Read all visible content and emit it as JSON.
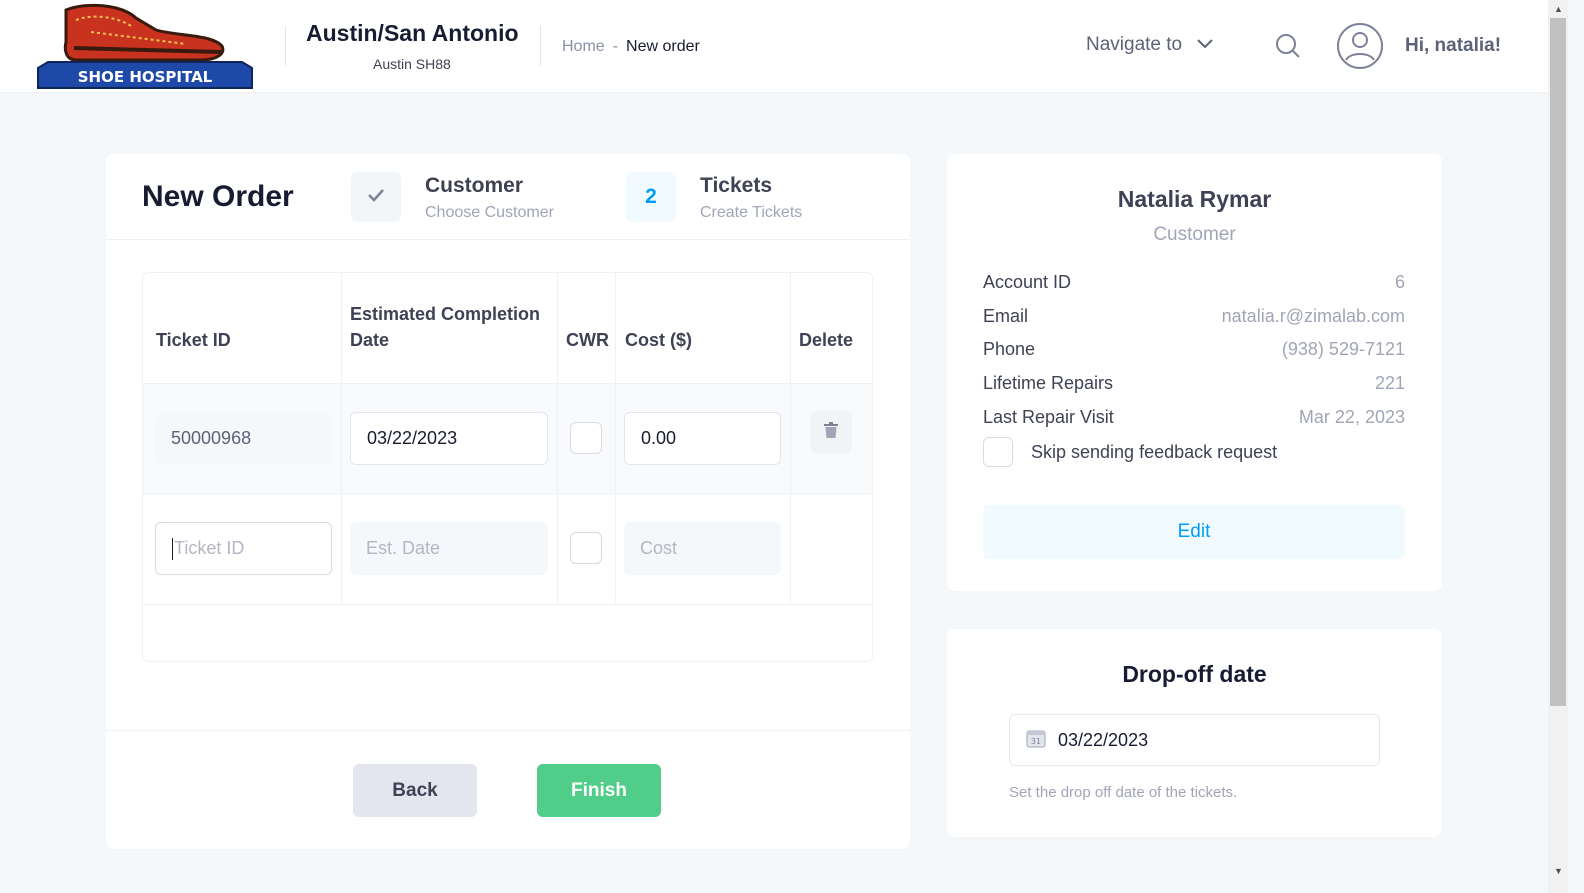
{
  "header": {
    "logo_text": "SHOE HOSPITAL",
    "store_name": "Austin/San Antonio",
    "store_sub": "Austin SH88",
    "breadcrumb": {
      "home": "Home",
      "separator": "-",
      "current": "New order"
    },
    "navigate_label": "Navigate to",
    "greeting": "Hi, natalia!",
    "icons": {
      "search": "search-icon",
      "avatar": "user-avatar-icon",
      "chevron": "chevron-down-icon"
    }
  },
  "order": {
    "title": "New Order",
    "steps": [
      {
        "title": "Customer",
        "subtitle": "Choose Customer",
        "status": "done",
        "icon": "check-icon"
      },
      {
        "title": "Tickets",
        "subtitle": "Create Tickets",
        "status": "current",
        "number": "2"
      }
    ],
    "table": {
      "headers": {
        "ticket_id": "Ticket ID",
        "est_date": "Estimated Completion Date",
        "cwr": "CWR",
        "cost": "Cost ($)",
        "delete": "Delete"
      },
      "rows": [
        {
          "ticket_id": "50000968",
          "est_date": "03/22/2023",
          "cwr": false,
          "cost": "0.00"
        }
      ],
      "new_row": {
        "ticket_placeholder": "Ticket ID",
        "date_placeholder": "Est. Date",
        "cost_placeholder": "Cost"
      }
    },
    "buttons": {
      "back": "Back",
      "finish": "Finish"
    }
  },
  "customer": {
    "name": "Natalia Rymar",
    "role": "Customer",
    "fields": [
      {
        "label": "Account ID",
        "value": "6"
      },
      {
        "label": "Email",
        "value": "natalia.r@zimalab.com"
      },
      {
        "label": "Phone",
        "value": "(938) 529-7121"
      },
      {
        "label": "Lifetime Repairs",
        "value": "221"
      },
      {
        "label": "Last Repair Visit",
        "value": "Mar 22, 2023"
      }
    ],
    "skip_feedback_label": "Skip sending feedback request",
    "skip_feedback_checked": false,
    "edit_label": "Edit"
  },
  "dropoff": {
    "title": "Drop-off date",
    "date": "03/22/2023",
    "calendar_day": "31",
    "help": "Set the drop off date of the tickets."
  },
  "colors": {
    "primary": "#009ef7",
    "success": "#50cd89",
    "background": "#f5f8fa"
  }
}
